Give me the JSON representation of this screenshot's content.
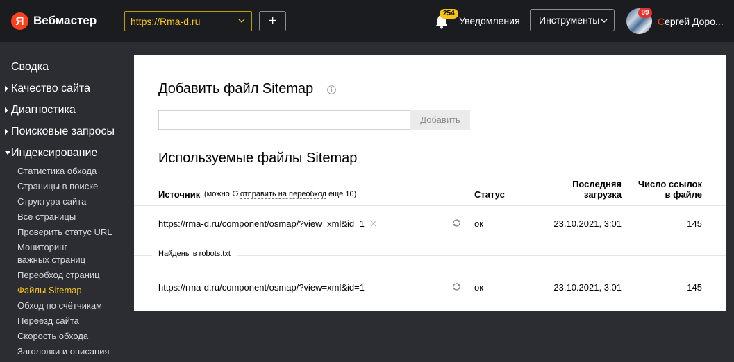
{
  "header": {
    "logo_letter": "Я",
    "brand": "Вебмастер",
    "site_select_value": "https://Rma-d.ru",
    "add_site_label": "+",
    "notifications_badge": "254",
    "notifications_label": "Уведомления",
    "tools_label": "Инструменты",
    "avatar_badge": "99",
    "user_name_first_letter": "С",
    "user_name_rest": "ергей Доро..."
  },
  "sidebar": {
    "top_items": [
      {
        "label": "Сводка",
        "arrow": "none"
      },
      {
        "label": "Качество сайта",
        "arrow": "closed"
      },
      {
        "label": "Диагностика",
        "arrow": "closed"
      },
      {
        "label": "Поисковые запросы",
        "arrow": "closed"
      },
      {
        "label": "Индексирование",
        "arrow": "open"
      }
    ],
    "sub_items": [
      {
        "label": "Статистика обхода"
      },
      {
        "label": "Страницы в поиске"
      },
      {
        "label": "Структура сайта"
      },
      {
        "label": "Все страницы"
      },
      {
        "label": "Проверить статус URL"
      },
      {
        "label": "Мониторинг\nважных страниц"
      },
      {
        "label": "Переобход страниц"
      },
      {
        "label": "Файлы Sitemap",
        "active": true
      },
      {
        "label": "Обход по счётчикам"
      },
      {
        "label": "Переезд сайта"
      },
      {
        "label": "Скорость обхода"
      },
      {
        "label": "Заголовки и описания"
      }
    ]
  },
  "main": {
    "add_title": "Добавить файл Sitemap",
    "input_value": "",
    "add_button": "Добавить",
    "used_title": "Используемые файлы Sitemap",
    "table": {
      "col_source": "Источник",
      "col_source_note_prefix": "(можно",
      "col_source_note_link": "отправить на переобход",
      "col_source_note_suffix": "еще 10)",
      "col_status": "Статус",
      "col_last_load_line1": "Последняя",
      "col_last_load_line2": "загрузка",
      "col_links_line1": "Число ссылок",
      "col_links_line2": "в файле"
    },
    "rows": [
      {
        "url": "https://rma-d.ru/component/osmap/?view=xml&id=1",
        "status": "ок",
        "date": "23.10.2021, 3:01",
        "links": "145"
      }
    ],
    "robots_section_label": "Найдены в robots.txt",
    "robots_rows": [
      {
        "url": "https://rma-d.ru/component/osmap/?view=xml&id=1",
        "status": "ок",
        "date": "23.10.2021, 3:01",
        "links": "145"
      }
    ]
  },
  "colors": {
    "header_bg": "#1b1c20",
    "page_bg": "#2b2d33",
    "accent_yellow": "#f5c518",
    "yandex_red": "#fc3f1d",
    "badge_red": "#e5322d"
  }
}
